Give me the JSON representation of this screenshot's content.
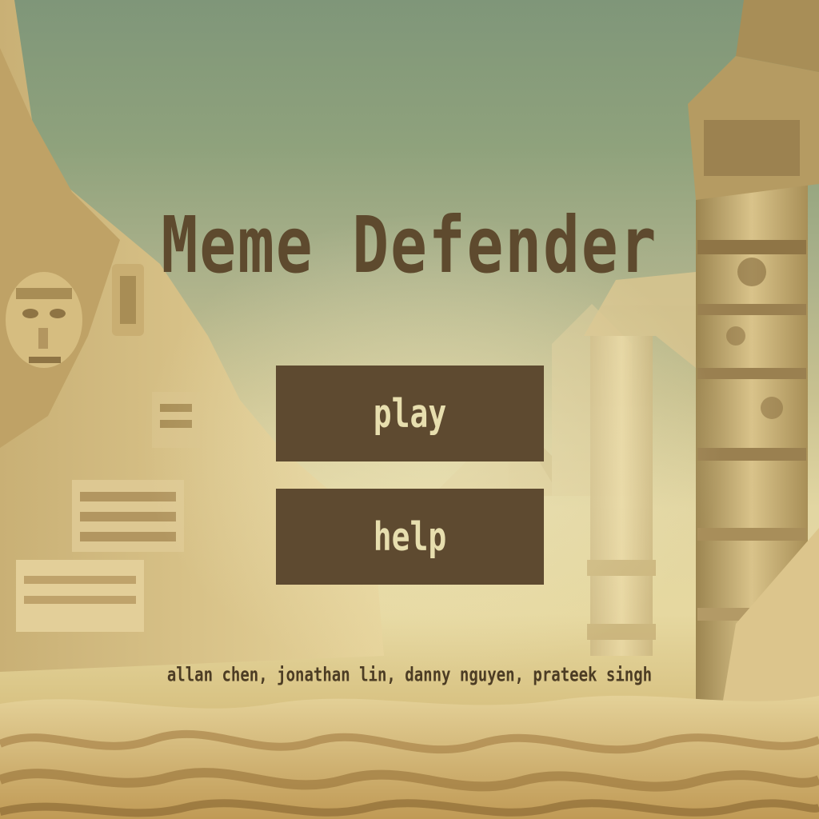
{
  "game": {
    "title": "Meme Defender",
    "menu": {
      "play_label": "play",
      "help_label": "help"
    },
    "credits": "allan chen, jonathan lin, danny nguyen, prateek singh"
  },
  "colors": {
    "title_text": "#5e4a2e",
    "button_bg": "#5e4a30",
    "button_text": "#e7deae",
    "credits_text": "#4c3c24",
    "sky_top": "#7f9679",
    "sand": "#d6bf7e"
  },
  "background": {
    "scene": "desert-ruins",
    "elements": [
      "carved-rock-cliff",
      "stone-columns",
      "pyramids",
      "sand-dunes"
    ]
  }
}
